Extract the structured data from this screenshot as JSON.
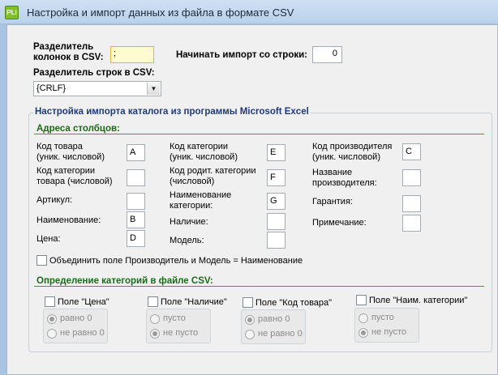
{
  "window": {
    "title": "Настройка и импорт данных из файла в формате CSV",
    "app_icon": "PLi"
  },
  "csv": {
    "col_sep_label_1": "Разделитель",
    "col_sep_label_2": "колонок в CSV:",
    "col_sep_value": ";",
    "start_row_label": "Начинать импорт со строки:",
    "start_row_value": "0",
    "row_sep_label": "Разделитель строк в CSV:",
    "row_sep_value": "{CRLF}"
  },
  "excel": {
    "group_title": "Настройка импорта каталога из программы Microsoft Excel",
    "columns_title": "Адреса столбцов:",
    "fields": {
      "product_code": {
        "l1": "Код товара",
        "l2": "(уник. числовой)",
        "value": "A"
      },
      "category_code": {
        "l1": "Код категории",
        "l2": "товара (числовой)",
        "value": ""
      },
      "article": {
        "l1": "Артикул:",
        "value": ""
      },
      "name": {
        "l1": "Наименование:",
        "value": "B"
      },
      "price": {
        "l1": "Цена:",
        "value": "D"
      },
      "cat_code": {
        "l1": "Код категории",
        "l2": "(уник. числовой)",
        "value": "E"
      },
      "parent_cat_code": {
        "l1": "Код родит. категории",
        "l2": "(числовой)",
        "value": "F"
      },
      "cat_name": {
        "l1": "Наименование",
        "l2": "категории:",
        "value": "G"
      },
      "availability": {
        "l1": "Наличие:",
        "value": ""
      },
      "model": {
        "l1": "Модель:",
        "value": ""
      },
      "manufacturer_code": {
        "l1": "Код производителя",
        "l2": "(уник. числовой)",
        "value": "C"
      },
      "manufacturer_name": {
        "l1": "Название",
        "l2": "производителя:",
        "value": ""
      },
      "warranty": {
        "l1": "Гарантия:",
        "value": ""
      },
      "note": {
        "l1": "Примечание:",
        "value": ""
      }
    },
    "merge_checkbox_label": "Объединить поле Производитель и Модель = Наименование",
    "cat_def_title": "Определение категорий в файле CSV:",
    "cat_filters": [
      {
        "label": "Поле \"Цена\"",
        "opt1": "равно 0",
        "opt2": "не равно 0",
        "selected": 1
      },
      {
        "label": "Поле \"Наличие\"",
        "opt1": "пусто",
        "opt2": "не пусто",
        "selected": 2
      },
      {
        "label": "Поле \"Код товара\"",
        "opt1": "равно 0",
        "opt2": "не равно 0",
        "selected": 1
      },
      {
        "label": "Поле \"Наим. категории\"",
        "opt1": "пусто",
        "opt2": "не пусто",
        "selected": 2
      }
    ]
  },
  "colors": {
    "section_green": "#1a6a1a",
    "group_title_blue": "#1f3a7a",
    "focus_yellow": "#fffbd0"
  }
}
